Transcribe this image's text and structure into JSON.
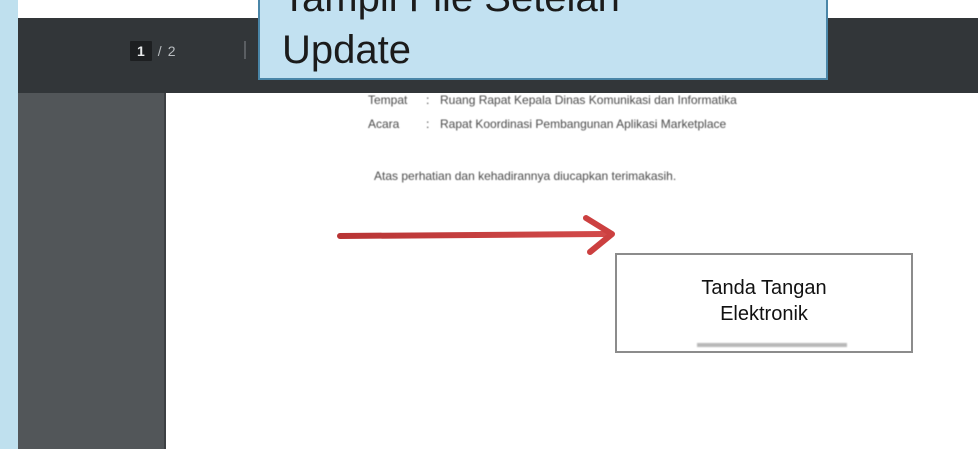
{
  "pager": {
    "current": "1",
    "separator": "/",
    "total": "2"
  },
  "document": {
    "lines": [
      {
        "label": "Tempat",
        "colon": ":",
        "value": "Ruang Rapat Kepala Dinas Komunikasi dan Informatika"
      },
      {
        "label": "Acara",
        "colon": ":",
        "value": "Rapat Koordinasi Pembangunan Aplikasi Marketplace"
      }
    ],
    "closing": "Atas perhatian dan kehadirannya diucapkan terimakasih."
  },
  "signature": {
    "line1": "Tanda Tangan",
    "line2": "Elektronik"
  },
  "callout": {
    "line1": "Tampil File Setelah",
    "line2": "Update"
  },
  "colors": {
    "toolbar": "#323639",
    "sidebar": "#525659",
    "callout_bg": "#c2e1f1",
    "callout_border": "#4a86a8",
    "arrow": "#c83a3a"
  },
  "icons": {
    "arrow": "right-arrow-icon"
  }
}
